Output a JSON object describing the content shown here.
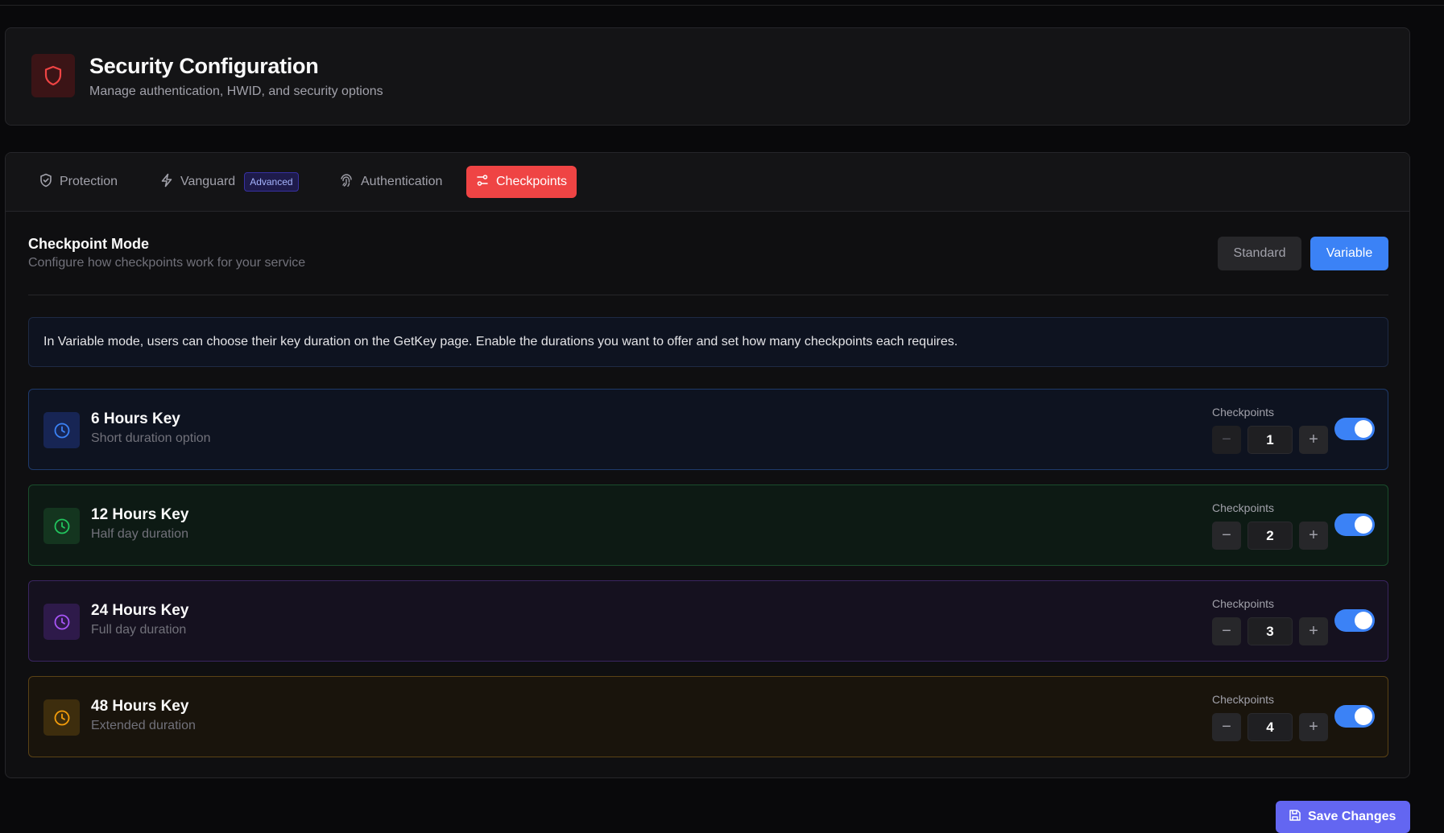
{
  "header": {
    "title": "Security Configuration",
    "subtitle": "Manage authentication, HWID, and security options"
  },
  "tabs": [
    {
      "label": "Protection",
      "icon": "shield-check-icon",
      "active": false
    },
    {
      "label": "Vanguard",
      "icon": "lightning-icon",
      "badge": "Advanced",
      "active": false
    },
    {
      "label": "Authentication",
      "icon": "fingerprint-icon",
      "active": false
    },
    {
      "label": "Checkpoints",
      "icon": "route-icon",
      "active": true
    }
  ],
  "mode": {
    "title": "Checkpoint Mode",
    "description": "Configure how checkpoints work for your service",
    "options": [
      "Standard",
      "Variable"
    ],
    "selected": "Variable"
  },
  "info": "In Variable mode, users can choose their key duration on the GetKey page. Enable the durations you want to offer and set how many checkpoints each requires.",
  "durations": [
    {
      "name": "6 Hours Key",
      "description": "Short duration option",
      "checkpoints_label": "Checkpoints",
      "value": "1",
      "enabled": true,
      "color": "#3b82f6"
    },
    {
      "name": "12 Hours Key",
      "description": "Half day duration",
      "checkpoints_label": "Checkpoints",
      "value": "2",
      "enabled": true,
      "color": "#22c55e"
    },
    {
      "name": "24 Hours Key",
      "description": "Full day duration",
      "checkpoints_label": "Checkpoints",
      "value": "3",
      "enabled": true,
      "color": "#a855f7"
    },
    {
      "name": "48 Hours Key",
      "description": "Extended duration",
      "checkpoints_label": "Checkpoints",
      "value": "4",
      "enabled": true,
      "color": "#f59e0b"
    }
  ],
  "save_label": "Save Changes",
  "colors": {
    "accent_red": "#ef4444",
    "accent_blue": "#3b82f6",
    "save_purple": "#6366f1"
  }
}
